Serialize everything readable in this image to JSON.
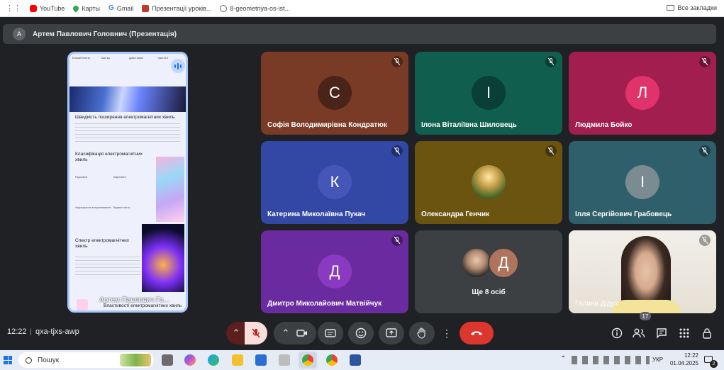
{
  "bookmarks": [
    {
      "label": "YouTube",
      "icon": "youtube-icon",
      "color": "#ff0000"
    },
    {
      "label": "Карты",
      "icon": "maps-pin-icon",
      "color": "#34a853"
    },
    {
      "label": "Gmail",
      "icon": "google-icon",
      "color": "#4285f4"
    },
    {
      "label": "Презентації уроків...",
      "icon": "bookmark-site-icon",
      "color": "#c0392b"
    },
    {
      "label": "8-geometriya-os-ist...",
      "icon": "globe-icon",
      "color": "#5f6368"
    }
  ],
  "bookmarks_all": "Все закладки",
  "presenter_bar": {
    "initial": "А",
    "title": "Артем Павлович Головнич (Презентація)"
  },
  "presentation": {
    "top_cols": [
      "Елементність",
      "Частка",
      "Довгі хвилі",
      "Частоти"
    ],
    "heading1": "Швидкість поширення електромагнітних хвиль",
    "heading2": "Класифікація електромагнітних хвиль",
    "heading3": "Спектр електромагнітних хвиль",
    "features": [
      "Радіохвилі",
      "Мікрохвилі",
      "Інфрачервоне випромінювання",
      "Видиме світло"
    ],
    "presenter_overlay": "Артем Павлович Го...",
    "caption": "Властивості електромагнітних хвиль"
  },
  "participants": [
    {
      "name": "Софія Володимирівна Кондратюк",
      "initial": "С",
      "bg": "#7a3b26",
      "avatar_bg": "#4a2418"
    },
    {
      "name": "Ілона Віталіївна Шиловець",
      "initial": "І",
      "bg": "#0f5e4e",
      "avatar_bg": "#0a3f35"
    },
    {
      "name": "Людмила Бойко",
      "initial": "Л",
      "bg": "#a21e4e",
      "avatar_bg": "#e0326b"
    },
    {
      "name": "Катерина Миколаївна Пукач",
      "initial": "К",
      "bg": "#3347a5",
      "avatar_bg": "#4556b8"
    },
    {
      "name": "Олександра Генчик",
      "initial": "",
      "bg": "#6a5410",
      "avatar_bg": "#8a7a3a"
    },
    {
      "name": "Ілля Сергійович Грабовець",
      "initial": "І",
      "bg": "#2f5f6a",
      "avatar_bg": "#7a8c92"
    },
    {
      "name": "Дмитро Миколайович Матвійчук",
      "initial": "Д",
      "bg": "#6a2aa0",
      "avatar_bg": "#8a3ac0"
    },
    {
      "name": "Ще 8 осіб",
      "initial": "Д",
      "bg": "#3c4043",
      "avatar_bg": "#b0735e"
    },
    {
      "name": "Галина Дідух",
      "initial": "",
      "bg": "#e8e4dc",
      "avatar_bg": "#c9a78e"
    }
  ],
  "controls": {
    "time": "12:22",
    "meeting_code": "qxa-tjxs-awp",
    "participant_count": "17"
  },
  "taskbar": {
    "search_placeholder": "Пошук",
    "lang": "УКР",
    "clock_time": "12:22",
    "clock_date": "01.04.2025",
    "notifications": "2"
  }
}
